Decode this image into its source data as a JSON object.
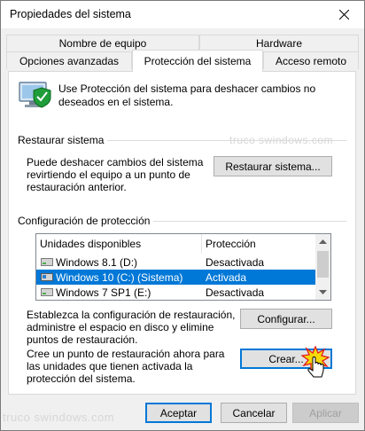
{
  "window": {
    "title": "Propiedades del sistema"
  },
  "tabs": {
    "row1": [
      {
        "label": "Nombre de equipo"
      },
      {
        "label": "Hardware"
      }
    ],
    "row2": [
      {
        "label": "Opciones avanzadas"
      },
      {
        "label": "Protección del sistema"
      },
      {
        "label": "Acceso remoto"
      }
    ],
    "active": "Protección del sistema"
  },
  "intro": {
    "text": "Use Protección del sistema para deshacer cambios no deseados en el sistema."
  },
  "restore": {
    "group_label": "Restaurar sistema",
    "description": "Puede deshacer cambios del sistema revirtiendo el equipo a un punto de restauración anterior.",
    "button_label": "Restaurar sistema..."
  },
  "protection": {
    "group_label": "Configuración de protección",
    "columns": [
      "Unidades disponibles",
      "Protección"
    ],
    "drives": [
      {
        "name": "Windows 8.1 (D:)",
        "status": "Desactivada",
        "selected": false
      },
      {
        "name": "Windows 10 (C:) (Sistema)",
        "status": "Activada",
        "selected": true
      },
      {
        "name": "Windows 7 SP1 (E:)",
        "status": "Desactivada",
        "selected": false
      }
    ],
    "configure_text": "Establezca la configuración de restauración, administre el espacio en disco y elimine puntos de restauración.",
    "configure_button": "Configurar...",
    "create_text": "Cree un punto de restauración ahora para las unidades que tienen activada la protección del sistema.",
    "create_button": "Crear..."
  },
  "footer": {
    "ok_label": "Aceptar",
    "cancel_label": "Cancelar",
    "apply_label": "Aplicar"
  },
  "watermark": "truco swindows.com",
  "colors": {
    "selection": "#0078d7",
    "window_bg": "#f0f0f0",
    "button_bg": "#e1e1e1"
  }
}
